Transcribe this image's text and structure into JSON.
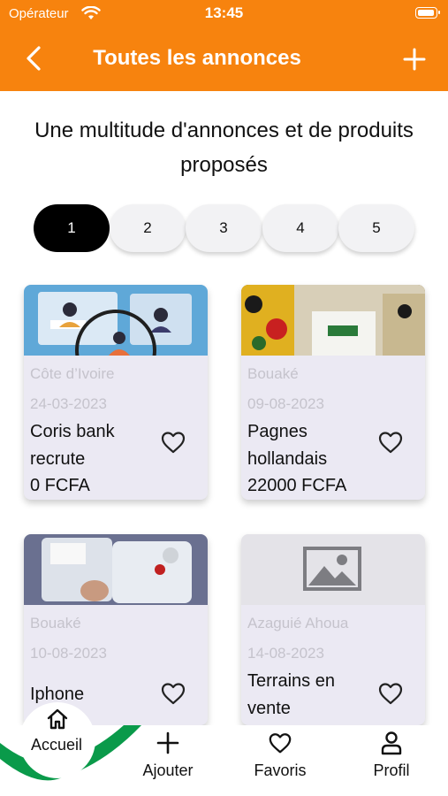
{
  "status_bar": {
    "carrier": "Opérateur",
    "time": "13:45"
  },
  "header": {
    "title": "Toutes les annonces",
    "back_icon": "chevron-left-icon",
    "add_icon": "plus-icon"
  },
  "intro": "Une multitude d'annonces et de produits proposés",
  "pagination": {
    "pages": [
      "1",
      "2",
      "3",
      "4",
      "5"
    ],
    "active": "1"
  },
  "ads": [
    {
      "location": "Côte d’Ivoire",
      "date": "24-03-2023",
      "title": "Coris bank recrute",
      "price": "0 FCFA"
    },
    {
      "location": "Bouaké",
      "date": "09-08-2023",
      "title": "Pagnes hollandais",
      "price": "22000 FCFA"
    },
    {
      "location": "Bouaké",
      "date": "10-08-2023",
      "title": "Iphone"
    },
    {
      "location": "Azaguié Ahoua",
      "date": "14-08-2023",
      "title": "Terrains en vente"
    }
  ],
  "bottom_nav": {
    "home": "Accueil",
    "add": "Ajouter",
    "favorites": "Favoris",
    "profile": "Profil"
  },
  "colors": {
    "header": "#f7830e",
    "accent_green": "#0a9a4a",
    "card_bg": "#ebe9f3",
    "active_page": "#000000"
  }
}
